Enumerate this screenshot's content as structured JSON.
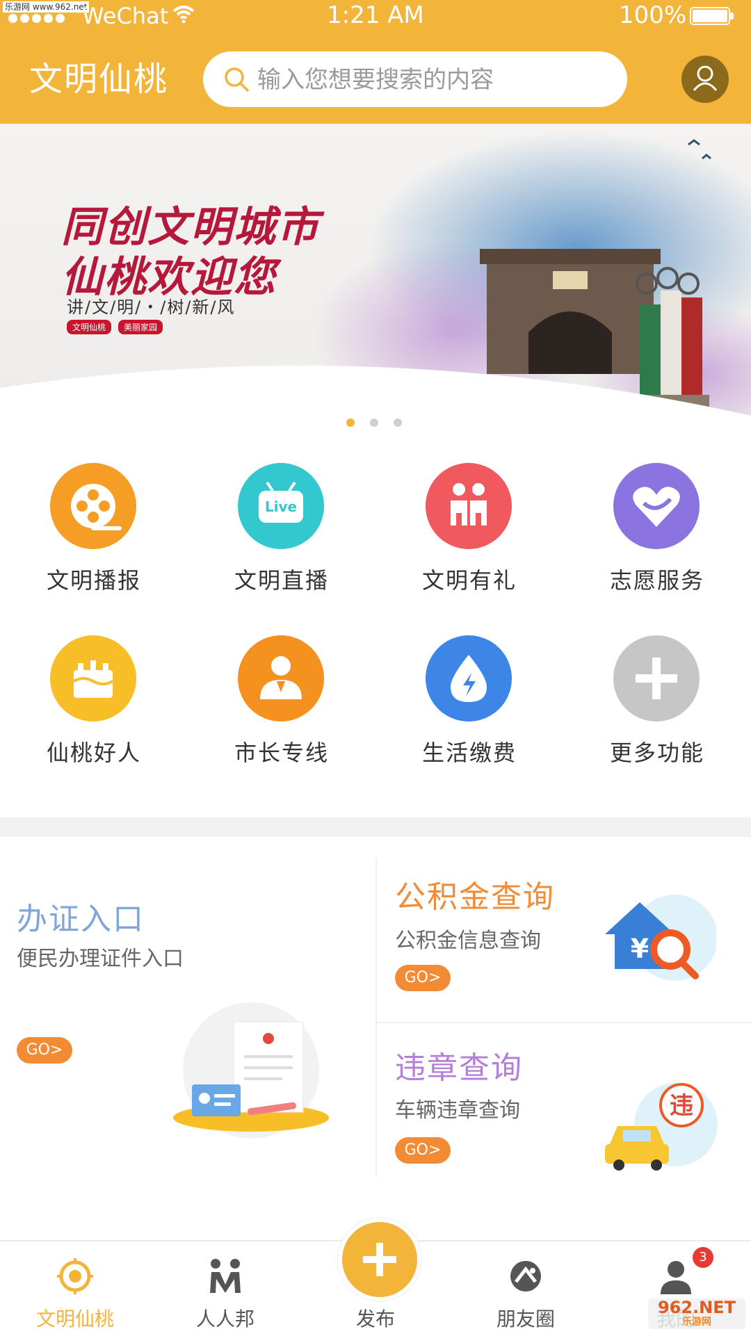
{
  "watermark_top": "乐游网 www.962.net",
  "status_bar": {
    "carrier": "WeChat",
    "time": "1:21 AM",
    "battery": "100%"
  },
  "header": {
    "title": "文明仙桃",
    "search_placeholder": "输入您想要搜索的内容"
  },
  "banner": {
    "line1": "同创文明城市",
    "line2": "仙桃欢迎您",
    "subtitle": "讲/文/明/・/树/新/风",
    "tags": [
      "文明仙桃",
      "美丽家园"
    ],
    "page_count": 3,
    "active_page": 1
  },
  "grid": {
    "items": [
      {
        "label": "文明播报",
        "color": "#F59D25",
        "icon": "film-reel-icon"
      },
      {
        "label": "文明直播",
        "color": "#33C7CF",
        "icon": "live-tv-icon"
      },
      {
        "label": "文明有礼",
        "color": "#F0595E",
        "icon": "people-icon"
      },
      {
        "label": "志愿服务",
        "color": "#8B74E0",
        "icon": "heart-hand-icon"
      },
      {
        "label": "仙桃好人",
        "color": "#F8BE28",
        "icon": "cake-icon"
      },
      {
        "label": "市长专线",
        "color": "#F5911E",
        "icon": "official-icon"
      },
      {
        "label": "生活缴费",
        "color": "#3D86E8",
        "icon": "water-drop-icon"
      },
      {
        "label": "更多功能",
        "color": "#C6C6C6",
        "icon": "plus-icon"
      }
    ]
  },
  "cards": {
    "license": {
      "title": "办证入口",
      "subtitle": "便民办理证件入口",
      "go": "GO>",
      "title_color": "#7FA6DA"
    },
    "fund": {
      "title": "公积金查询",
      "subtitle": "公积金信息查询",
      "go": "GO>",
      "title_color": "#F38A34"
    },
    "violation": {
      "title": "违章查询",
      "subtitle": "车辆违章查询",
      "go": "GO>",
      "title_color": "#B37FD9"
    }
  },
  "violation_stamp": "违",
  "bottom_nav": {
    "items": [
      {
        "label": "文明仙桃",
        "active": true
      },
      {
        "label": "人人邦",
        "active": false
      },
      {
        "label": "发布",
        "active": false
      },
      {
        "label": "朋友圈",
        "active": false
      },
      {
        "label": "我的",
        "active": false
      }
    ],
    "badge": "3"
  },
  "watermark_bottom": {
    "main": "962.NET",
    "sub": "乐游网"
  },
  "colors": {
    "accent": "#F3B43A",
    "go_button": "#F38A34"
  }
}
